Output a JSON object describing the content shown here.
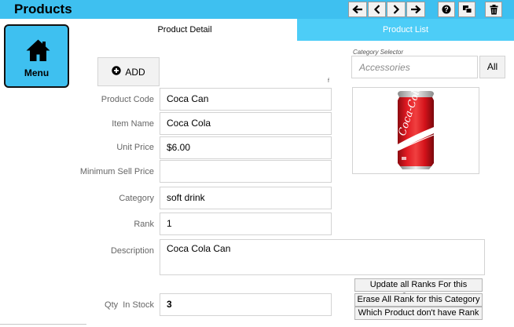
{
  "app": {
    "title": "Products"
  },
  "toolbar": {
    "icons": [
      "arrow-left-end-icon",
      "chevron-left-icon",
      "chevron-right-icon",
      "arrow-right-end-icon",
      "help-icon",
      "copy-icon",
      "trash-icon"
    ]
  },
  "nav": {
    "home_label": "Menu"
  },
  "tabs": {
    "detail": "Product Detail",
    "list": "Product List"
  },
  "add_button": {
    "label": "ADD"
  },
  "small_mark": "f",
  "category_selector": {
    "label": "Category Selector",
    "value": "Accessories",
    "all_label": "All"
  },
  "form": {
    "product_code": {
      "label": "Product Code",
      "value": "Coca Can"
    },
    "item_name": {
      "label": "Item Name",
      "value": "Coca Cola"
    },
    "unit_price": {
      "label": "Unit Price",
      "value": "$6.00"
    },
    "min_sell_price": {
      "label": "Minimum Sell Price",
      "value": ""
    },
    "category": {
      "label": "Category",
      "value": "soft drink"
    },
    "rank": {
      "label": "Rank",
      "value": "1"
    },
    "description": {
      "label": "Description",
      "value": "Coca Cola Can"
    },
    "qty": {
      "label": "Qty  In Stock",
      "value": "3"
    }
  },
  "rank_buttons": {
    "update": "Update all Ranks For this Category",
    "erase": "Erase All Rank for this Category",
    "which": "Which Product don't have Rank"
  },
  "colors": {
    "accent": "#3ec0f0",
    "tab_active_bg": "#4dcdf7",
    "can_red": "#d4121a"
  }
}
